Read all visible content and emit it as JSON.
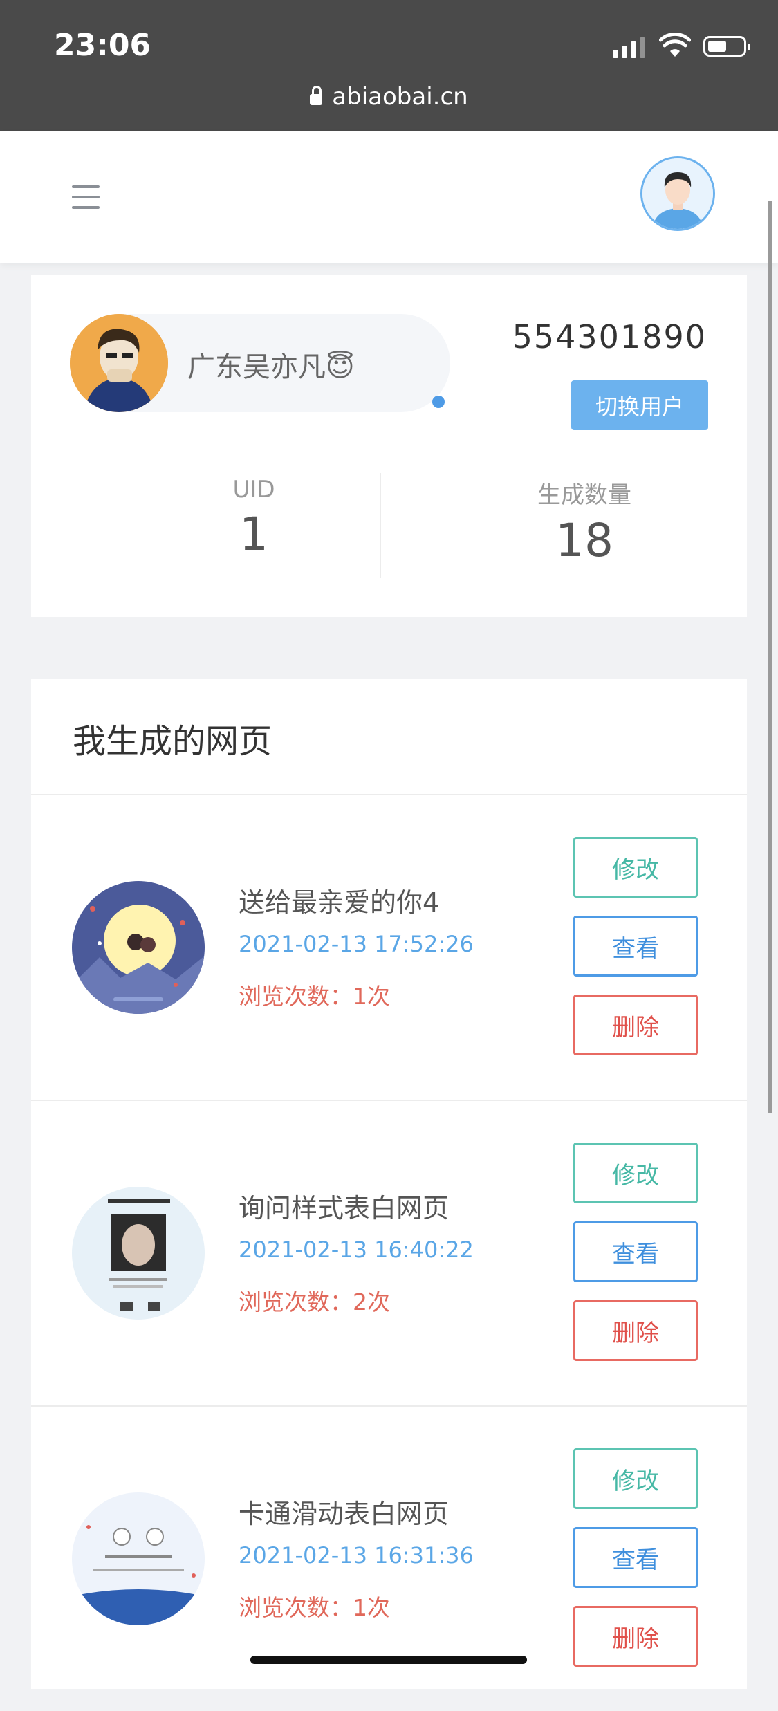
{
  "status_bar": {
    "time": "23:06",
    "url": "abiaobai.cn",
    "battery_level": 0.55
  },
  "header": {
    "menu_icon": "hamburger-icon",
    "avatar_icon": "user-avatar-icon"
  },
  "profile": {
    "nickname": "广东吴亦凡😇",
    "qq": "554301890",
    "switch_label": "切换用户",
    "uid_label": "UID",
    "uid_value": "1",
    "count_label": "生成数量",
    "count_value": "18"
  },
  "list": {
    "title": "我生成的网页",
    "items": [
      {
        "title": "送给最亲爱的你4",
        "date": "2021-02-13 17:52:26",
        "views": "浏览次数：1次",
        "edit": "修改",
        "view": "查看",
        "delete": "删除"
      },
      {
        "title": "询问样式表白网页",
        "date": "2021-02-13 16:40:22",
        "views": "浏览次数：2次",
        "edit": "修改",
        "view": "查看",
        "delete": "删除"
      },
      {
        "title": "卡通滑动表白网页",
        "date": "2021-02-13 16:31:36",
        "views": "浏览次数：1次",
        "edit": "修改",
        "view": "查看",
        "delete": "删除"
      }
    ]
  },
  "colors": {
    "edit": "#46b8a5",
    "view": "#3f8fdd",
    "delete": "#e0504a",
    "date": "#5aa6e6",
    "accent": "#6cb2ee"
  }
}
